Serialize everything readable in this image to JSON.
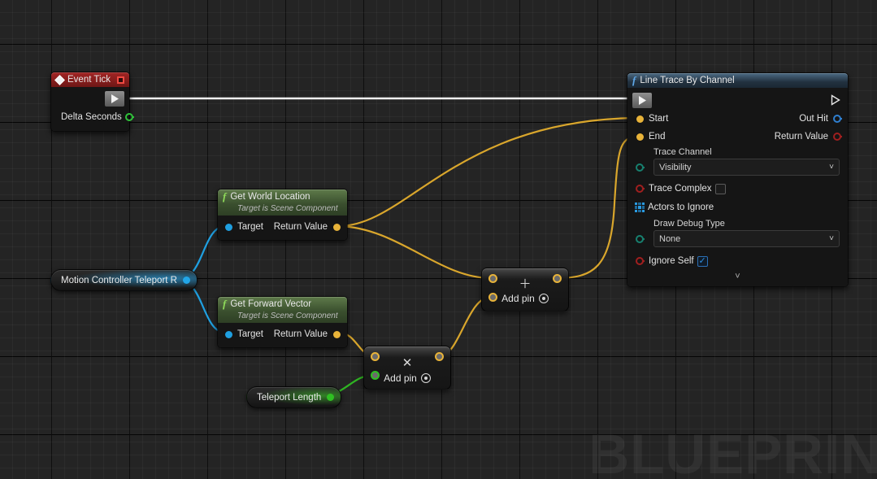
{
  "app": {
    "watermark": "BLUEPRIN"
  },
  "graph": {
    "nodes": {
      "event_tick": {
        "title": "Event Tick",
        "title_icon": "event-diamond-icon",
        "badge_icon": "delegate-square-icon",
        "exec_out_label": "",
        "outputs": [
          {
            "label": "Delta Seconds",
            "type": "float",
            "color": "#30c23a"
          }
        ]
      },
      "line_trace": {
        "title": "Line Trace By Channel",
        "title_icon": "function-f-icon",
        "inputs": [
          {
            "label": "Start",
            "type": "vector",
            "color": "#e8b339"
          },
          {
            "label": "End",
            "type": "vector",
            "color": "#e8b339"
          }
        ],
        "outputs": [
          {
            "label": "Out Hit",
            "type": "struct",
            "color": "#2f7fd0"
          },
          {
            "label": "Return Value",
            "type": "bool",
            "color": "#a01f1f"
          }
        ],
        "trace_channel": {
          "label": "Trace Channel",
          "value": "Visibility",
          "pin_color": "#17806f"
        },
        "trace_complex": {
          "label": "Trace Complex",
          "checked": false,
          "pin_color": "#a01f1f"
        },
        "actors_to_ignore": {
          "label": "Actors to Ignore",
          "pin_icon": "array-grid-icon"
        },
        "draw_debug_type": {
          "label": "Draw Debug Type",
          "value": "None",
          "pin_color": "#17806f"
        },
        "ignore_self": {
          "label": "Ignore Self",
          "checked": true,
          "pin_color": "#a01f1f"
        },
        "collapse_icon": "chevron-down-icon"
      },
      "get_world_location": {
        "title": "Get World Location",
        "subtitle": "Target is Scene Component",
        "title_icon": "function-f-icon",
        "input": {
          "label": "Target",
          "color": "#1f9fe0"
        },
        "output": {
          "label": "Return Value",
          "color": "#e8b339"
        }
      },
      "get_forward_vector": {
        "title": "Get Forward Vector",
        "subtitle": "Target is Scene Component",
        "title_icon": "function-f-icon",
        "input": {
          "label": "Target",
          "color": "#1f9fe0"
        },
        "output": {
          "label": "Return Value",
          "color": "#e8b339"
        }
      },
      "motion_controller": {
        "label": "Motion Controller Teleport R",
        "pin_color": "#22a6e8"
      },
      "teleport_length": {
        "label": "Teleport Length",
        "pin_color": "#2fc022"
      },
      "multiply": {
        "operator": "✕",
        "add_pin_label": "Add pin",
        "add_pin_icon": "add-pin-icon"
      },
      "add": {
        "operator": "＋",
        "add_pin_label": "Add pin",
        "add_pin_icon": "add-pin-icon"
      }
    }
  },
  "colors": {
    "exec_white": "#f5f5f5",
    "vector_yellow": "#e8b339",
    "float_green": "#2fc022",
    "object_blue": "#1f9fe0",
    "bool_red": "#a01f1f",
    "struct_blue": "#2f7fd0",
    "enum_teal": "#17806f"
  }
}
